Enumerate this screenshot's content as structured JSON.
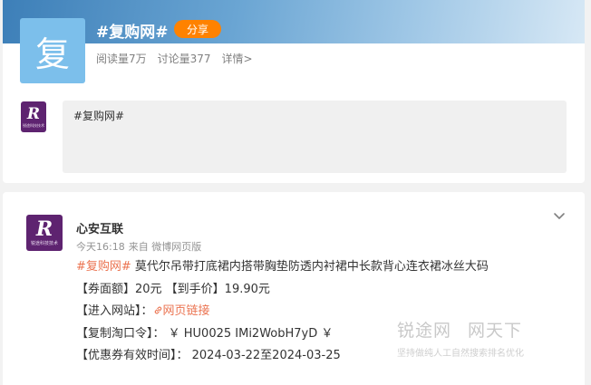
{
  "topic": {
    "avatar_char": "复",
    "title": "#复购网#",
    "share_label": "分享",
    "reads": "阅读量7万",
    "discussions": "讨论量377",
    "detail_link": "详情>"
  },
  "brand_logo": {
    "mark": "R",
    "subtitle": "锐途科技技术"
  },
  "compose": {
    "value": "#复购网#"
  },
  "post": {
    "author": "心安互联",
    "time": "今天16:18",
    "source": "来自 微博网页版",
    "lines": [
      {
        "hashtag": "#复购网#",
        "text": " 莫代尔吊带打底裙内搭带胸垫防透内衬裙中长款背心连衣裙冰丝大码"
      },
      {
        "text": "【券面额】20元 【到手价】19.90元"
      },
      {
        "label": "【进入网站】：",
        "link": "网页链接"
      },
      {
        "text": "【复制淘口令】： ￥ HU0025 IMi2WobH7yD ￥"
      },
      {
        "text": "【优惠券有效时间】： 2024-03-22至2024-03-25"
      }
    ]
  },
  "watermark": {
    "left": "锐途网",
    "right": "网天下",
    "tagline": "坚持做纯人工自然搜索排名优化"
  },
  "colors": {
    "accent_orange": "#ff8200",
    "link_orange": "#eb7350",
    "brand_purple": "#5e2370"
  }
}
